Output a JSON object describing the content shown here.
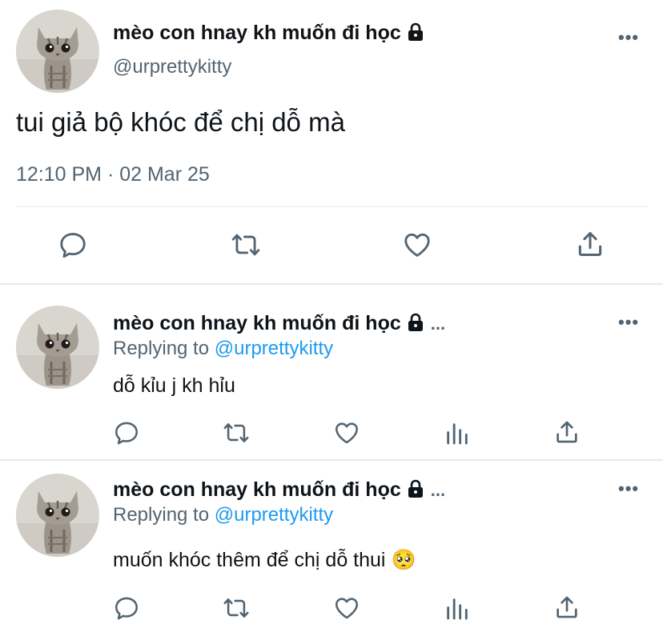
{
  "main_tweet": {
    "display_name": "mèo con hnay kh muốn đi học",
    "handle": "@urprettykitty",
    "text": "tui giả bộ khóc để chị dỗ mà",
    "timestamp": "12:10 PM · 02 Mar 25",
    "more_label": "•••",
    "actions": [
      "reply-icon",
      "retweet-icon",
      "like-icon",
      "share-icon"
    ]
  },
  "replies": [
    {
      "display_name": "mèo con hnay kh muốn đi học",
      "name_ellipsis": "...",
      "replying_prefix": "Replying to",
      "replying_handle": "@urprettykitty",
      "text": "dỗ kỉu j kh hỉu",
      "more_label": "•••",
      "actions": [
        "reply-icon",
        "retweet-icon",
        "like-icon",
        "analytics-icon",
        "share-icon"
      ]
    },
    {
      "display_name": "mèo con hnay kh muốn đi học",
      "name_ellipsis": "...",
      "replying_prefix": "Replying to",
      "replying_handle": "@urprettykitty",
      "text": "muốn khóc thêm để chị dỗ thui",
      "emoji": "🥺",
      "more_label": "•••",
      "actions": [
        "reply-icon",
        "retweet-icon",
        "like-icon",
        "analytics-icon",
        "share-icon"
      ]
    }
  ],
  "colors": {
    "text": "#0f1419",
    "muted": "#536471",
    "link": "#1d9bf0",
    "divider": "#e6e9ec"
  }
}
